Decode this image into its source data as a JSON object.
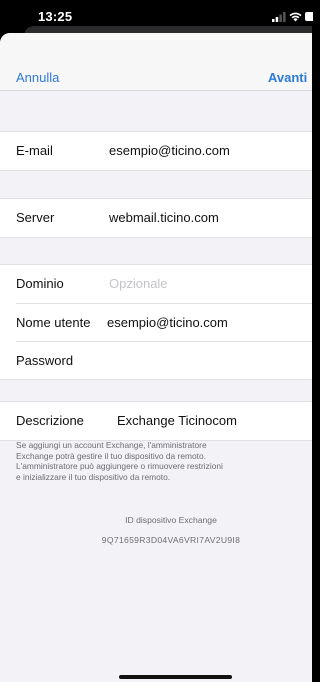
{
  "status_bar": {
    "time": "13:25"
  },
  "nav": {
    "cancel_label": "Annulla",
    "next_label": "Avanti"
  },
  "account": {
    "email": {
      "label": "E-mail",
      "value": "esempio@ticino.com"
    },
    "server": {
      "label": "Server",
      "value": "webmail.ticino.com"
    },
    "domain": {
      "label": "Dominio",
      "placeholder": "Opzionale"
    },
    "username": {
      "label": "Nome utente",
      "value": "esempio@ticino.com"
    },
    "password": {
      "label": "Password",
      "value": ""
    },
    "description": {
      "label": "Descrizione",
      "value": "Exchange Ticinocom"
    }
  },
  "footer": {
    "note": "Se aggiungi un account Exchange, l'amministratore\nExchange potrà gestire il tuo dispositivo da remoto.\nL'amministratore può aggiungere o rimuovere restrizioni\ne inizializzare il tuo dispositivo da remoto.",
    "device_id_label": "ID dispositivo Exchange",
    "device_id": "9Q71659R3D04VA6VRI7AV2U9I8"
  },
  "colors": {
    "accent": "#2f7ad8",
    "background": "#f2f2f7",
    "placeholder": "#c4c4c8"
  },
  "icons": [
    "signal-icon",
    "wifi-icon",
    "battery-icon"
  ]
}
